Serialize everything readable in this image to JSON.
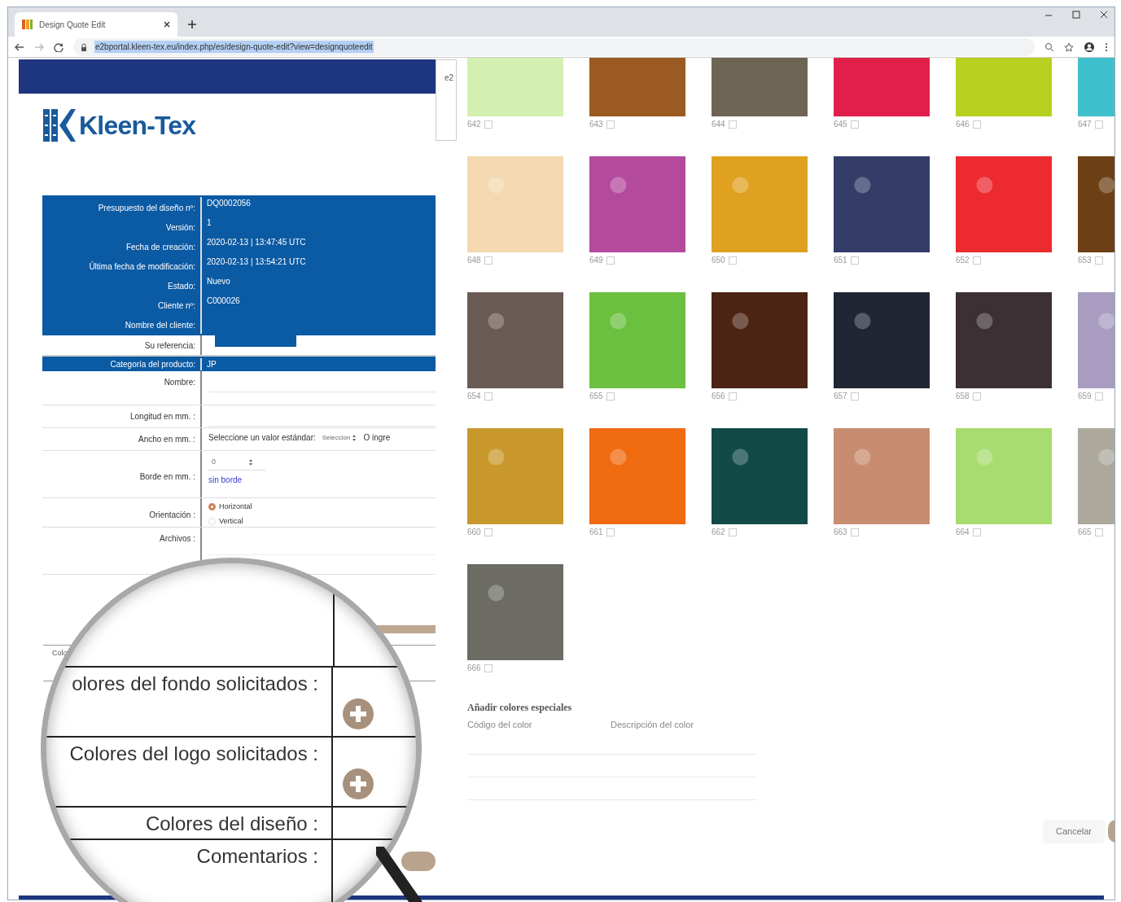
{
  "browser": {
    "tab_title": "Design Quote Edit",
    "url": "e2bportal.kleen-tex.eu/index.php/es/design-quote-edit?view=designquoteedit"
  },
  "logo": {
    "text": "Kleen-Tex"
  },
  "popup": {
    "text": "e2"
  },
  "quote_info": [
    {
      "label": "Presupuesto del diseño nº:",
      "value": "DQ0002056"
    },
    {
      "label": "Versión:",
      "value": "1"
    },
    {
      "label": "Fecha de creación:",
      "value": "2020-02-13 | 13:47:45 UTC"
    },
    {
      "label": "Última fecha de modificación:",
      "value": "2020-02-13 | 13:54:21 UTC"
    },
    {
      "label": "Estado:",
      "value": "Nuevo"
    },
    {
      "label": "Cliente nº:",
      "value": "C000026"
    },
    {
      "label": "Nombre del cliente:"
    }
  ],
  "reference": {
    "label": "Su referencia:"
  },
  "category": {
    "label": "Categoría del producto:",
    "value": "JP"
  },
  "form_rows": [
    {
      "label": "Nombre:",
      "kind": "text"
    },
    {
      "label": "Longitud en mm. :",
      "kind": "text"
    },
    {
      "label": "Ancho en mm. :",
      "kind": "select",
      "prompt": "Seleccione un valor estándar:",
      "select_value": "Seleccion",
      "other": "O ingre"
    },
    {
      "label": "Borde en mm. :",
      "kind": "number",
      "value": "0",
      "link": "sin borde"
    },
    {
      "label": "Orientación :",
      "kind": "radio",
      "options": [
        {
          "label": "Horizontal",
          "selected": true
        },
        {
          "label": "Vertical",
          "selected": false
        }
      ]
    },
    {
      "label": "Archivos :",
      "kind": "files"
    }
  ],
  "background_label": "Colo",
  "magnifier": {
    "rows": [
      {
        "label": "olores del fondo solicitados :",
        "add_button": true
      },
      {
        "label": "Colores del logo solicitados :",
        "add_button": true
      },
      {
        "label": "Colores del diseño :",
        "add_button": false
      },
      {
        "label": "Comentarios :",
        "add_button": false
      }
    ]
  },
  "swatches": [
    {
      "code": "642",
      "color": "#d4f0b0",
      "checked": false
    },
    {
      "code": "643",
      "color": "#9a5a22",
      "checked": false
    },
    {
      "code": "644",
      "color": "#6e6454",
      "checked": false
    },
    {
      "code": "645",
      "color": "#e0204a",
      "checked": false
    },
    {
      "code": "646",
      "color": "#b8d020",
      "checked": false
    },
    {
      "code": "647",
      "color": "#40c0cc",
      "checked": false
    },
    {
      "code": "648",
      "color": "#f4d8b0",
      "checked": false
    },
    {
      "code": "649",
      "color": "#b44a9c",
      "checked": false
    },
    {
      "code": "650",
      "color": "#e0a020",
      "checked": false
    },
    {
      "code": "651",
      "color": "#343c68",
      "checked": false
    },
    {
      "code": "652",
      "color": "#ec2a30",
      "checked": false
    },
    {
      "code": "653",
      "color": "#6c4014",
      "checked": false
    },
    {
      "code": "654",
      "color": "#6a5a54",
      "checked": false
    },
    {
      "code": "655",
      "color": "#6cc040",
      "checked": false
    },
    {
      "code": "656",
      "color": "#4c2414",
      "checked": false
    },
    {
      "code": "657",
      "color": "#202634",
      "checked": false
    },
    {
      "code": "658",
      "color": "#3c3034",
      "checked": false
    },
    {
      "code": "659",
      "color": "#a89cc0",
      "checked": false
    },
    {
      "code": "660",
      "color": "#c8982c",
      "checked": false
    },
    {
      "code": "661",
      "color": "#f06a10",
      "checked": false
    },
    {
      "code": "662",
      "color": "#124a48",
      "checked": false
    },
    {
      "code": "663",
      "color": "#c88c70",
      "checked": false
    },
    {
      "code": "664",
      "color": "#a8dc70",
      "checked": false
    },
    {
      "code": "665",
      "color": "#aca89c",
      "checked": false
    },
    {
      "code": "666",
      "color": "#6c6c64",
      "checked": false
    }
  ],
  "special_colors": {
    "title": "Añadir colores especiales",
    "code_label": "Código del color",
    "description_label": "Descripción del color"
  },
  "cancel_button": "Cancelar"
}
